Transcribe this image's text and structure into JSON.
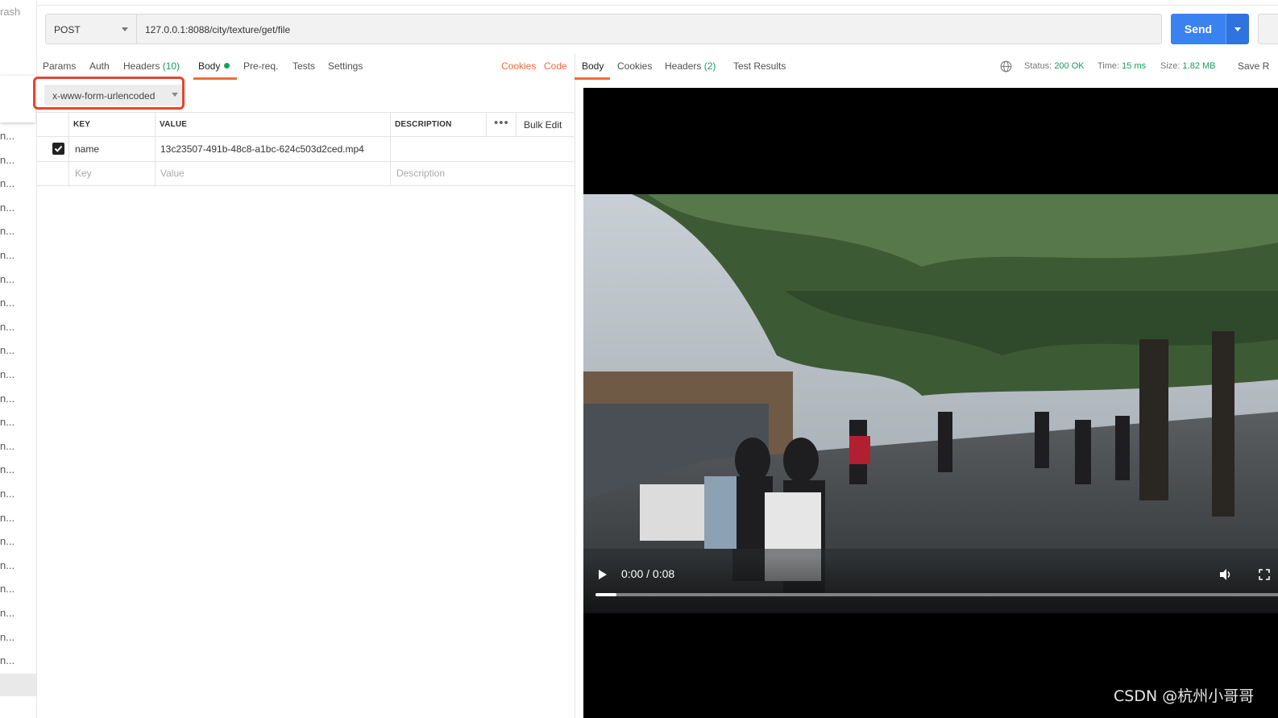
{
  "sidebar": {
    "trash_label": "rash",
    "truncated_item": "n..."
  },
  "request": {
    "method": "POST",
    "url": "127.0.0.1:8088/city/texture/get/file",
    "send_label": "Send"
  },
  "request_tabs": {
    "params": "Params",
    "auth": "Auth",
    "headers": "Headers",
    "headers_count": "(10)",
    "body": "Body",
    "prereq": "Pre-req.",
    "tests": "Tests",
    "settings": "Settings",
    "cookies": "Cookies",
    "code": "Code"
  },
  "body_mode": "x-www-form-urlencoded",
  "table": {
    "headers": {
      "key": "KEY",
      "value": "VALUE",
      "description": "DESCRIPTION"
    },
    "bulk_edit": "Bulk Edit",
    "rows": [
      {
        "checked": true,
        "key": "name",
        "value": "13c23507-491b-48c8-a1bc-624c503d2ced.mp4",
        "description": ""
      }
    ],
    "placeholder": {
      "key": "Key",
      "value": "Value",
      "description": "Description"
    }
  },
  "response": {
    "tabs": {
      "body": "Body",
      "cookies": "Cookies",
      "headers": "Headers",
      "headers_count": "(2)",
      "test_results": "Test Results"
    },
    "status_label": "Status:",
    "status_value": "200 OK",
    "time_label": "Time:",
    "time_value": "15 ms",
    "size_label": "Size:",
    "size_value": "1.82 MB",
    "save_label": "Save R"
  },
  "video": {
    "time": "0:00 / 0:08",
    "progress": 0.03
  },
  "watermark": "CSDN @杭州小哥哥",
  "colors": {
    "accent": "#f26b3a",
    "send_button": "#3b82f1",
    "success": "#16a05c",
    "highlight": "#e8432f"
  }
}
